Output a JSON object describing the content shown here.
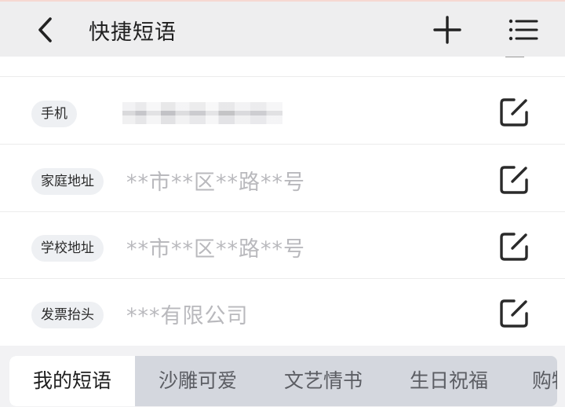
{
  "header": {
    "title": "快捷短语",
    "back_icon": "chevron-left-icon",
    "add_icon": "plus-icon",
    "menu_icon": "list-menu-icon"
  },
  "phrases": [
    {
      "tag": "手机",
      "value": ""
    },
    {
      "tag": "家庭地址",
      "value": "**市**区**路**号"
    },
    {
      "tag": "学校地址",
      "value": "**市**区**路**号"
    },
    {
      "tag": "发票抬头",
      "value": "***有限公司"
    }
  ],
  "tabs": [
    {
      "label": "我的短语",
      "active": true
    },
    {
      "label": "沙雕可爱",
      "active": false
    },
    {
      "label": "文艺情书",
      "active": false
    },
    {
      "label": "生日祝福",
      "active": false
    },
    {
      "label": "购物",
      "active": false
    }
  ],
  "colors": {
    "header_bg": "#eeeeef",
    "tag_bg": "#eef0f3",
    "placeholder_text": "#b9b9bd",
    "tab_bar_bg": "#d4d7de",
    "active_tab_bg": "#ffffff"
  }
}
